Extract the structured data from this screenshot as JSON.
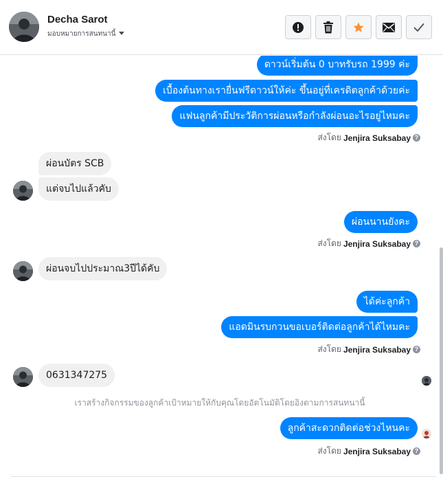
{
  "header": {
    "contact_name": "Decha Sarot",
    "subtitle": "มอบหมายการสนทนานี้",
    "actions": [
      {
        "name": "report",
        "icon": "exclamation-icon"
      },
      {
        "name": "delete",
        "icon": "trash-icon"
      },
      {
        "name": "star",
        "icon": "star-icon",
        "color": "#f7923b"
      },
      {
        "name": "mark-unread",
        "icon": "envelope-icon"
      },
      {
        "name": "mark-done",
        "icon": "check-icon"
      }
    ]
  },
  "colors": {
    "outgoing_bubble": "#0084ff",
    "incoming_bubble": "#f1f0f0",
    "star": "#f7923b"
  },
  "messages": {
    "out_1": "ดาวน์เริ่มต้น 0 บาทรับรถ 1999 ค่ะ",
    "out_2": "เบื้องต้นทางเรายื่นฟรีดาวน์ให้ค่ะ ขึ้นอยู่ที่เครดิตลูกค้าด้วยค่ะ",
    "out_3": "แฟนลูกค้ามีประวัติการผ่อนหรือกำลังผ่อนอะไรอยู่ไหมคะ",
    "in_1": "ผ่อนบัตร SCB",
    "in_2": "แต่จบไปแล้วคับ",
    "out_4": "ผ่อนนานยังคะ",
    "in_3": "ผ่อนจบไปประมาณ3ปีได้คับ",
    "out_5": "ได้ค่ะลูกค้า",
    "out_6": "แอดมินรบกวนขอเบอร์ติดต่อลูกค้าได้ไหมคะ",
    "in_4": "0631347275",
    "system_note": "เราสร้างกิจกรรมของลูกค้าเป้าหมายให้กับคุณโดยอัตโนมัติโดยอิงตามการสนทนานี้",
    "out_7": "ลูกค้าสะดวกติดต่อช่วงไหนคะ"
  },
  "sent_by": {
    "prefix": "ส่งโดย",
    "agent": "Jenjira Suksabay",
    "help_icon": "question-icon"
  }
}
